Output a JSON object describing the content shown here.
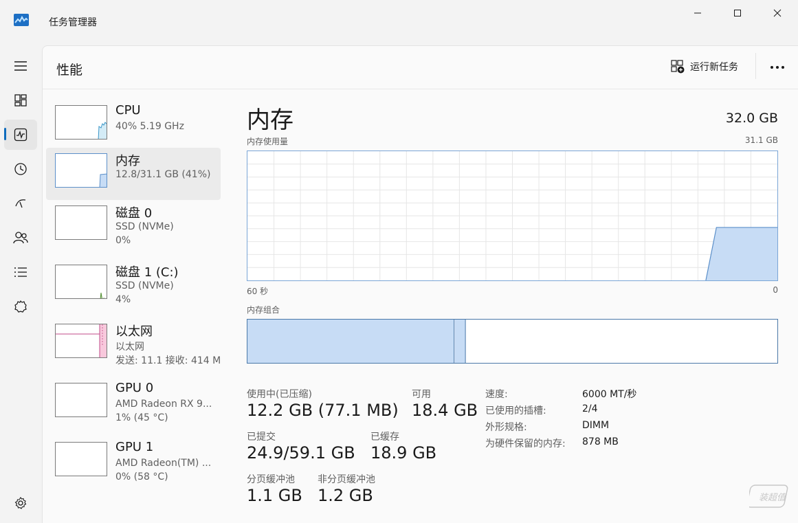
{
  "window": {
    "title": "任务管理器",
    "icon": "task-manager-icon"
  },
  "nav": {
    "items": [
      {
        "icon": "hamburger-menu-icon"
      },
      {
        "icon": "processes-icon"
      },
      {
        "icon": "performance-icon",
        "active": true
      },
      {
        "icon": "app-history-icon"
      },
      {
        "icon": "startup-apps-icon"
      },
      {
        "icon": "users-icon"
      },
      {
        "icon": "details-icon"
      },
      {
        "icon": "services-icon"
      },
      {
        "icon": "settings-icon"
      }
    ]
  },
  "header": {
    "page_title": "性能",
    "run_task_label": "运行新任务",
    "more_label": "•••"
  },
  "devices": [
    {
      "name": "CPU",
      "sub1": "40%  5.19 GHz",
      "sub2": "",
      "selected": false
    },
    {
      "name": "内存",
      "sub1": "12.8/31.1 GB (41%)",
      "sub2": "",
      "selected": true
    },
    {
      "name": "磁盘 0",
      "sub1": "SSD (NVMe)",
      "sub2": "0%",
      "selected": false
    },
    {
      "name": "磁盘 1 (C:)",
      "sub1": "SSD (NVMe)",
      "sub2": "4%",
      "selected": false
    },
    {
      "name": "以太网",
      "sub1": "以太网",
      "sub2": "发送: 11.1  接收: 414 M",
      "selected": false
    },
    {
      "name": "GPU 0",
      "sub1": "AMD Radeon RX 9...",
      "sub2": "1% (45 °C)",
      "selected": false
    },
    {
      "name": "GPU 1",
      "sub1": "AMD Radeon(TM) ...",
      "sub2": "0% (58 °C)",
      "selected": false
    }
  ],
  "detail": {
    "title": "内存",
    "total": "32.0 GB",
    "usage_label": "内存使用量",
    "usage_max": "31.1 GB",
    "axis_left": "60 秒",
    "axis_right": "0",
    "composition_label": "内存组合",
    "usage_fraction_recent": 0.41,
    "composition_in_use_fraction": 0.39,
    "composition_modified_fraction": 0.02
  },
  "stats": {
    "in_use_label": "使用中(已压缩)",
    "in_use_value": "12.2 GB (77.1 MB)",
    "available_label": "可用",
    "available_value": "18.4 GB",
    "committed_label": "已提交",
    "committed_value": "24.9/59.1 GB",
    "cached_label": "已缓存",
    "cached_value": "18.9 GB",
    "paged_label": "分页缓冲池",
    "paged_value": "1.1 GB",
    "nonpaged_label": "非分页缓冲池",
    "nonpaged_value": "1.2 GB"
  },
  "specs": [
    {
      "label": "速度:",
      "value": "6000 MT/秒"
    },
    {
      "label": "已使用的插槽:",
      "value": "2/4"
    },
    {
      "label": "外形规格:",
      "value": "DIMM"
    },
    {
      "label": "为硬件保留的内存:",
      "value": "878 MB"
    }
  ],
  "colors": {
    "memory_fill": "#c7dcf5",
    "memory_line": "#5b8fc9",
    "cpu_line": "#3a96c8",
    "disk_line": "#4c8a2a",
    "ethernet_line": "#c04a88",
    "gpu_line": "#8a5fc0",
    "accent": "#0f6cbd"
  },
  "watermark": {
    "text": "装超值"
  }
}
